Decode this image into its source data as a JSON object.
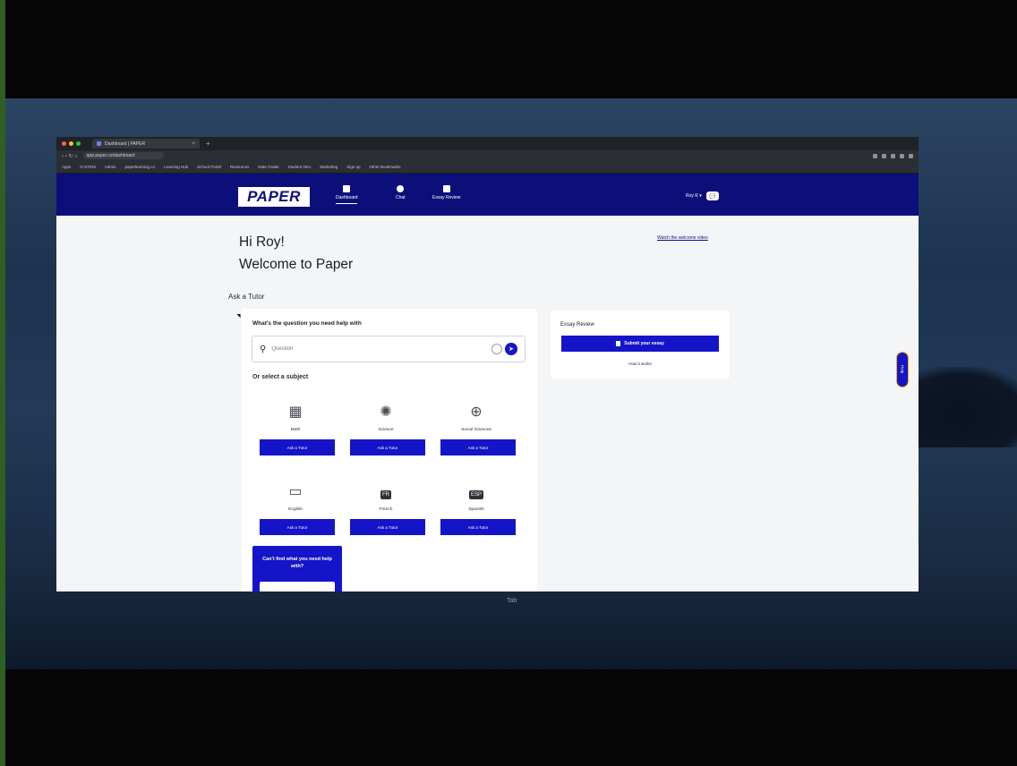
{
  "browser": {
    "tab_title": "Dashboard | PAPER",
    "tab_close": "×",
    "new_tab": "+",
    "url": "app.paper.co/dashboard",
    "nav_glyphs": "‹ › ↻ ⌂",
    "bookmarks": [
      "Apps",
      "G-STEM",
      "Admin",
      "paperlearning.co",
      "Learning Hub",
      "School Portal",
      "Resources",
      "Rate Grade",
      "Student Intro",
      "Marketing",
      "Sign up",
      "Other Bookmarks"
    ]
  },
  "header": {
    "logo": "PAPER",
    "nav": [
      {
        "label": "Dashboard"
      },
      {
        "label": "Chat"
      },
      {
        "label": "Essay Review"
      }
    ],
    "user_name": "Roy R ▾",
    "chat_badge": "💬"
  },
  "page": {
    "greeting": "Hi Roy!",
    "welcome": "Welcome to Paper",
    "welcome_link": "Watch the welcome video",
    "ask_label": "Ask a Tutor"
  },
  "ask_card": {
    "question_title": "What's the question you need help with",
    "search_placeholder": "Question",
    "send_glyph": "➤",
    "select_label": "Or select a subject",
    "subjects": [
      {
        "name": "Math",
        "button": "Ask a Tutor",
        "icon": "calculator-icon"
      },
      {
        "name": "Science",
        "button": "Ask a Tutor",
        "icon": "atom-icon"
      },
      {
        "name": "Social Sciences",
        "button": "Ask a Tutor",
        "icon": "globe-icon"
      },
      {
        "name": "English",
        "button": "Ask a Tutor",
        "icon": "book-icon"
      },
      {
        "name": "French",
        "button": "Ask a Tutor",
        "icon": "french-bubble-icon",
        "icon_text": "FR"
      },
      {
        "name": "Spanish",
        "button": "Ask a Tutor",
        "icon": "spanish-bubble-icon",
        "icon_text": "ESP"
      }
    ],
    "cant_find_text": "Can't find what you need help with?"
  },
  "essay_card": {
    "title": "Essay Review",
    "submit_button": "Submit your essay",
    "how_it_works": "How it works"
  },
  "help_tab": "Help",
  "dock_label": "Tab",
  "colors": {
    "brand_navy": "#0c0f7a",
    "brand_blue": "#1414c9",
    "page_bg": "#f4f5f7"
  }
}
